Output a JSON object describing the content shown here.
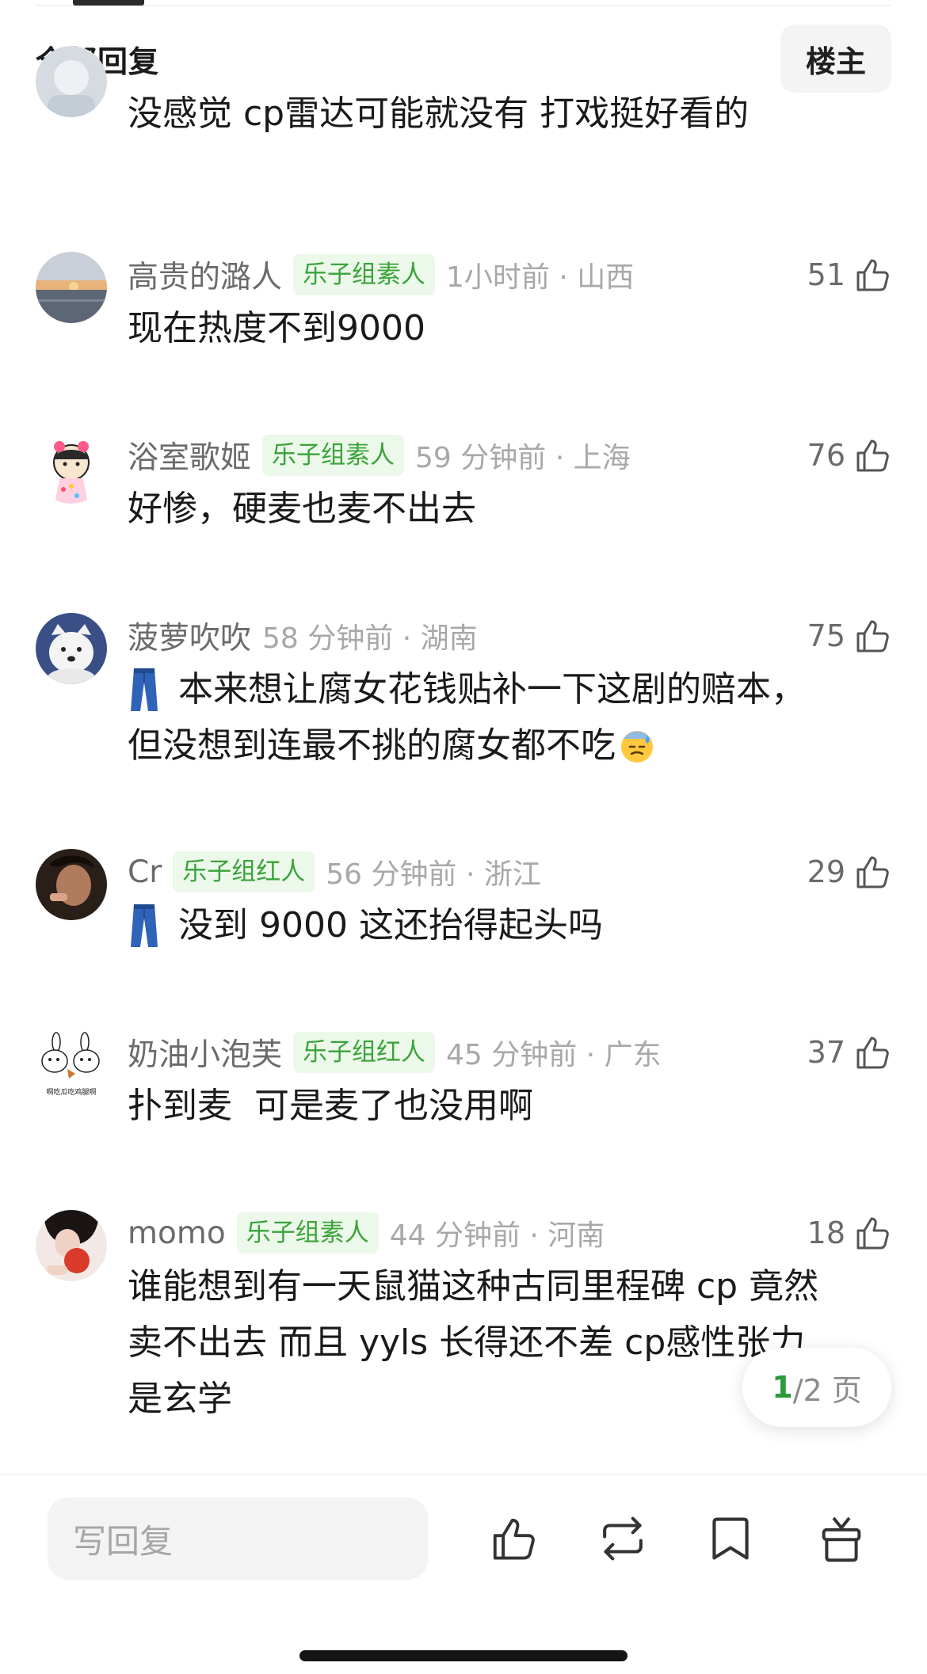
{
  "header": {
    "title": "全部回复",
    "filter_label": "楼主"
  },
  "comments": [
    {
      "name": "",
      "badge": "",
      "time": "",
      "likes": "",
      "text": "没感觉 cp雷达可能就没有 打戏挺好看的",
      "avatar_icon": "user-avatar-icon"
    },
    {
      "name": "高贵的潞人",
      "badge": "乐子组素人",
      "time": "1小时前 · 山西",
      "likes": "51",
      "text": "现在热度不到9000",
      "avatar_icon": "sunset-avatar-icon"
    },
    {
      "name": "浴室歌姬",
      "badge": "乐子组素人",
      "time": "59 分钟前 · 上海",
      "likes": "76",
      "text": "好惨，硬麦也麦不出去",
      "avatar_icon": "cartoon-avatar-icon"
    },
    {
      "name": "菠萝吹吹",
      "badge": "",
      "time": "58 分钟前 · 湖南",
      "likes": "75",
      "text_lines": [
        "本来想让腐女花钱贴补一下这剧的赔本，",
        "但没想到连最不挑的腐女都不吃"
      ],
      "avatar_icon": "dog-avatar-icon"
    },
    {
      "name": "Cr",
      "badge": "乐子组红人",
      "time": "56 分钟前 · 浙江",
      "likes": "29",
      "text": "没到 9000 这还抬得起头吗",
      "avatar_icon": "portrait-avatar-icon"
    },
    {
      "name": "奶油小泡芙",
      "badge": "乐子组红人",
      "time": "45 分钟前 · 广东",
      "likes": "37",
      "text": "扑到麦  可是麦了也没用啊",
      "avatar_icon": "bunny-avatar-icon",
      "avatar_caption": "啊吃瓜吃鸡腿啊"
    },
    {
      "name": "momo",
      "badge": "乐子组素人",
      "time": "44 分钟前 · 河南",
      "likes": "18",
      "text_lines": [
        "谁能想到有一天鼠猫这种古同里程碑 cp 竟然",
        "卖不出去 而且 yyls 长得还不差 cp感性张力",
        "是玄学"
      ],
      "avatar_icon": "apple-avatar-icon"
    }
  ],
  "pager": {
    "current": "1",
    "total_label": "/2 页"
  },
  "bottom_bar": {
    "reply_placeholder": "写回复",
    "icons": [
      "like-icon",
      "repost-icon",
      "bookmark-icon",
      "gift-icon"
    ]
  },
  "colors": {
    "badge_bg": "#ecf8ea",
    "badge_text": "#3aa33a",
    "pager_current": "#2d9b3a"
  }
}
